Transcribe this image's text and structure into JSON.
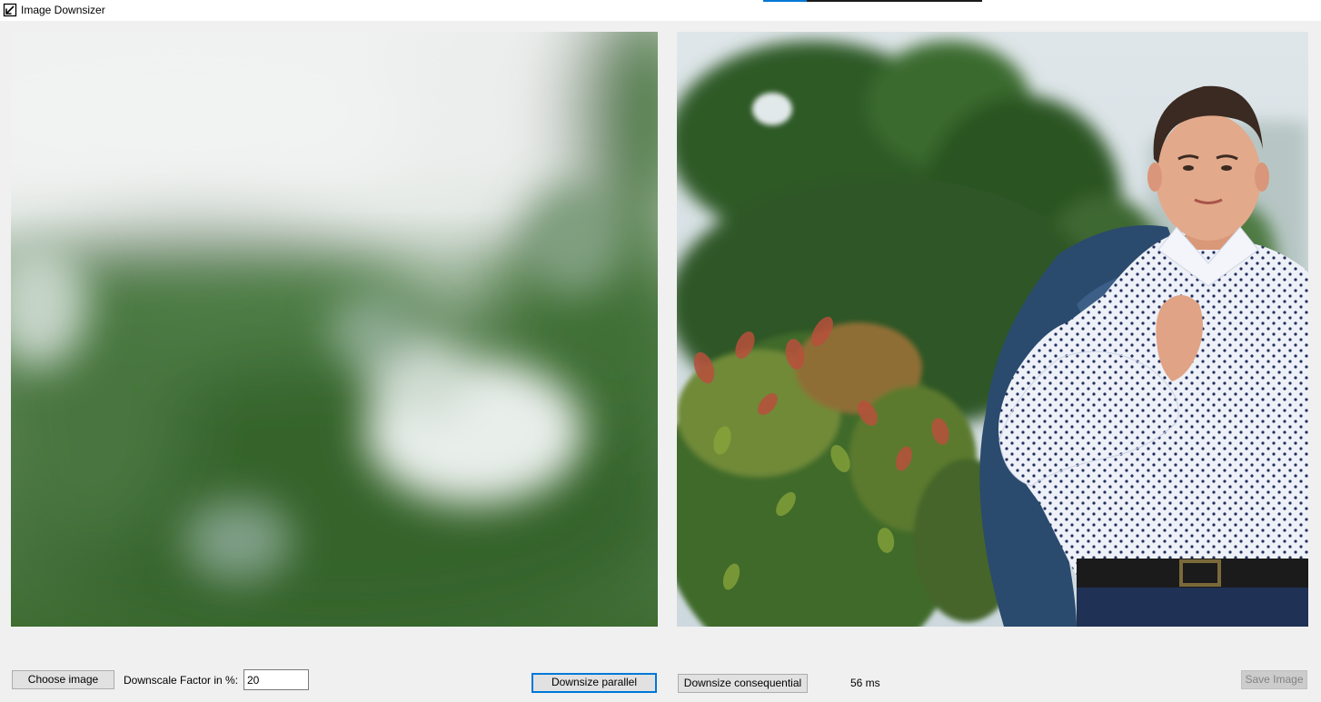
{
  "window": {
    "title": "Image Downsizer",
    "icon": "resize-arrow-icon"
  },
  "colors": {
    "accent": "#0078d7",
    "window_bg": "#f0f0f0",
    "button_bg": "#e1e1e1"
  },
  "images": {
    "left": "blurred downscaled image (green foliage bokeh)",
    "right": "original image (young man in white dotted shirt holding a blue jacket over shoulder, green shrubs and tree background)"
  },
  "controls": {
    "choose_image_label": "Choose image",
    "factor_label": "Downscale Factor in %:",
    "factor_value": "20",
    "parallel_label": "Downsize parallel",
    "consequential_label": "Downsize consequential",
    "timing": "56 ms",
    "save_label": "Save Image"
  }
}
